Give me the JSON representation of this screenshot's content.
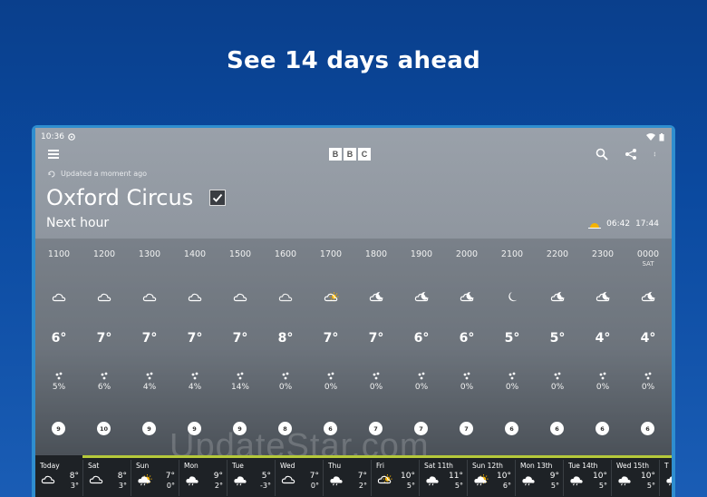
{
  "headline": "See 14 days ahead",
  "status": {
    "time": "10:36"
  },
  "brand": [
    "B",
    "B",
    "C"
  ],
  "updated": "Updated a moment ago",
  "location": "Oxford Circus",
  "subtitle": "Next hour",
  "sunrise": "06:42",
  "sunset": "17:44",
  "hourly": [
    {
      "time": "1100",
      "day": "",
      "icon": "cloud-icon",
      "temp": "6°",
      "rain": "5%",
      "wind": "9"
    },
    {
      "time": "1200",
      "day": "",
      "icon": "cloud-icon",
      "temp": "7°",
      "rain": "6%",
      "wind": "10"
    },
    {
      "time": "1300",
      "day": "",
      "icon": "cloud-icon",
      "temp": "7°",
      "rain": "4%",
      "wind": "9"
    },
    {
      "time": "1400",
      "day": "",
      "icon": "cloud-icon",
      "temp": "7°",
      "rain": "4%",
      "wind": "9"
    },
    {
      "time": "1500",
      "day": "",
      "icon": "cloud-icon",
      "temp": "7°",
      "rain": "14%",
      "wind": "9"
    },
    {
      "time": "1600",
      "day": "",
      "icon": "light-cloud-icon",
      "temp": "8°",
      "rain": "0%",
      "wind": "8"
    },
    {
      "time": "1700",
      "day": "",
      "icon": "sun-cloud-icon",
      "temp": "7°",
      "rain": "0%",
      "wind": "6"
    },
    {
      "time": "1800",
      "day": "",
      "icon": "moon-cloud-icon",
      "temp": "7°",
      "rain": "0%",
      "wind": "7"
    },
    {
      "time": "1900",
      "day": "",
      "icon": "moon-cloud-icon",
      "temp": "6°",
      "rain": "0%",
      "wind": "7"
    },
    {
      "time": "2000",
      "day": "",
      "icon": "moon-cloud-icon",
      "temp": "6°",
      "rain": "0%",
      "wind": "7"
    },
    {
      "time": "2100",
      "day": "",
      "icon": "moon-icon",
      "temp": "5°",
      "rain": "0%",
      "wind": "6"
    },
    {
      "time": "2200",
      "day": "",
      "icon": "moon-cloud-icon",
      "temp": "5°",
      "rain": "0%",
      "wind": "6"
    },
    {
      "time": "2300",
      "day": "",
      "icon": "moon-cloud-icon",
      "temp": "4°",
      "rain": "0%",
      "wind": "6"
    },
    {
      "time": "0000",
      "day": "SAT",
      "icon": "moon-cloud-icon",
      "temp": "4°",
      "rain": "0%",
      "wind": "6"
    }
  ],
  "daily": [
    {
      "name": "Today",
      "icon": "cloud-icon",
      "hi": "8°",
      "lo": "3°"
    },
    {
      "name": "Sat",
      "icon": "cloud-icon",
      "hi": "8°",
      "lo": "3°"
    },
    {
      "name": "Sun",
      "icon": "sun-rain-icon",
      "hi": "7°",
      "lo": "0°"
    },
    {
      "name": "Mon",
      "icon": "rain-icon",
      "hi": "9°",
      "lo": "2°"
    },
    {
      "name": "Tue",
      "icon": "rain-icon",
      "hi": "5°",
      "lo": "-3°"
    },
    {
      "name": "Wed",
      "icon": "cloud-icon",
      "hi": "7°",
      "lo": "0°"
    },
    {
      "name": "Thu",
      "icon": "rain-icon",
      "hi": "7°",
      "lo": "2°"
    },
    {
      "name": "Fri",
      "icon": "sun-cloud-icon",
      "hi": "10°",
      "lo": "5°"
    },
    {
      "name": "Sat 11th",
      "icon": "rain-icon",
      "hi": "11°",
      "lo": "5°"
    },
    {
      "name": "Sun 12th",
      "icon": "sun-rain-icon",
      "hi": "10°",
      "lo": "6°"
    },
    {
      "name": "Mon 13th",
      "icon": "rain-icon",
      "hi": "9°",
      "lo": "5°"
    },
    {
      "name": "Tue 14th",
      "icon": "rain-icon",
      "hi": "10°",
      "lo": "5°"
    },
    {
      "name": "Wed 15th",
      "icon": "rain-icon",
      "hi": "10°",
      "lo": "5°"
    },
    {
      "name": "T",
      "icon": "rain-icon",
      "hi": "",
      "lo": ""
    }
  ],
  "watermark": "UpdateStar.com"
}
